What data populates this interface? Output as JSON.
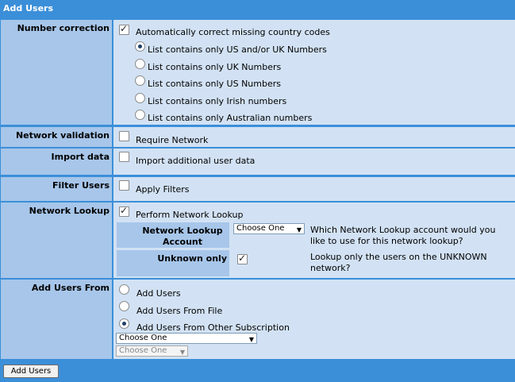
{
  "panel": {
    "title": "Add Users"
  },
  "number_correction": {
    "label": "Number correction",
    "auto_correct": {
      "label": "Automatically correct missing country codes",
      "checked": true
    },
    "options": [
      {
        "label": "List contains only US and/or UK Numbers",
        "selected": true
      },
      {
        "label": "List contains only UK Numbers",
        "selected": false
      },
      {
        "label": "List contains only US Numbers",
        "selected": false
      },
      {
        "label": "List contains only Irish numbers",
        "selected": false
      },
      {
        "label": "List contains only Australian numbers",
        "selected": false
      }
    ]
  },
  "network_validation": {
    "label": "Network validation",
    "checkbox_label": "Require Network",
    "checked": false
  },
  "import_data": {
    "label": "Import data",
    "checkbox_label": "Import additional user data",
    "checked": false
  },
  "filter_users": {
    "label": "Filter Users",
    "checkbox_label": "Apply Filters",
    "checked": false
  },
  "network_lookup": {
    "label": "Network Lookup",
    "checkbox_label": "Perform Network Lookup",
    "checked": true,
    "account": {
      "label": "Network Lookup Account",
      "select_value": "Choose One",
      "help": "Which Network Lookup account would you like to use for this network lookup?"
    },
    "unknown_only": {
      "label": "Unknown only",
      "checked": true,
      "help": "Lookup only the users on the UNKNOWN network?"
    }
  },
  "add_users_from": {
    "label": "Add Users From",
    "options": [
      {
        "label": "Add Users",
        "selected": false
      },
      {
        "label": "Add Users From File",
        "selected": false
      },
      {
        "label": "Add Users From Other Subscription",
        "selected": true
      }
    ],
    "subscription_select": "Choose One",
    "secondary_select": "Choose One"
  },
  "submit": {
    "label": "Add Users"
  }
}
